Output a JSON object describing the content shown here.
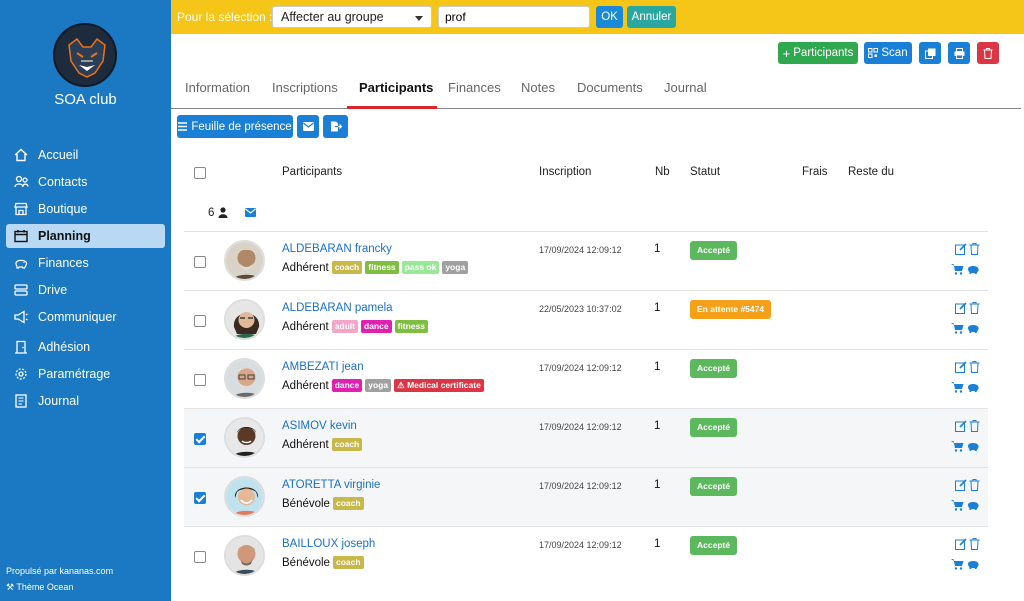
{
  "sidebar": {
    "club_name": "SOA club",
    "items": [
      {
        "label": "Accueil",
        "icon": "home-icon"
      },
      {
        "label": "Contacts",
        "icon": "users-icon"
      },
      {
        "label": "Boutique",
        "icon": "store-icon"
      },
      {
        "label": "Planning",
        "icon": "calendar-icon",
        "active": true
      },
      {
        "label": "Finances",
        "icon": "piggy-bank-icon"
      },
      {
        "label": "Drive",
        "icon": "drive-icon"
      },
      {
        "label": "Communiquer",
        "icon": "megaphone-icon"
      },
      {
        "label": "Adhésion",
        "icon": "door-icon"
      },
      {
        "label": "Paramétrage",
        "icon": "gear-icon"
      },
      {
        "label": "Journal",
        "icon": "journal-icon"
      }
    ],
    "footer_powered": "Propulsé par kananas.com",
    "footer_theme": "Thème Ocean"
  },
  "selection_bar": {
    "label": "Pour la sélection :",
    "action_value": "Affecter au groupe",
    "group_value": "prof",
    "ok_label": "OK",
    "cancel_label": "Annuler"
  },
  "actions": {
    "participants_label": "Participants",
    "scan_label": "Scan"
  },
  "tabs": [
    "Information",
    "Inscriptions",
    "Participants",
    "Finances",
    "Notes",
    "Documents",
    "Journal"
  ],
  "active_tab": "Participants",
  "toolbar": {
    "presence_label": "Feuille de présence"
  },
  "table": {
    "headers": {
      "participants": "Participants",
      "inscription": "Inscription",
      "nb": "Nb",
      "statut": "Statut",
      "frais": "Frais",
      "reste": "Reste du"
    },
    "count": "6"
  },
  "colors": {
    "coach": "#c8b84a",
    "fitness": "#7fbf3f",
    "pass_ok": "#98e898",
    "yoga": "#a0a0a0",
    "adult": "#f4a6c8",
    "dance": "#e020b0",
    "medical": "#dc3545",
    "accepte": "#5cb85c",
    "en_attente": "#f6a01a"
  },
  "rows": [
    {
      "name": "ALDEBARAN francky",
      "type": "Adhérent",
      "tags": [
        "coach",
        "fitness",
        "pass ok",
        "yoga"
      ],
      "date": "17/09/2024 12:09:12",
      "nb": "1",
      "status": "Accepté",
      "checked": false
    },
    {
      "name": "ALDEBARAN pamela",
      "type": "Adhérent",
      "tags": [
        "adult",
        "dance",
        "fitness"
      ],
      "date": "22/05/2023 10:37:02",
      "nb": "1",
      "status": "En attente #5474",
      "checked": false
    },
    {
      "name": "AMBEZATI jean",
      "type": "Adhérent",
      "tags": [
        "dance",
        "yoga",
        "Medical certificate"
      ],
      "date": "17/09/2024 12:09:12",
      "nb": "1",
      "status": "Accepté",
      "checked": false
    },
    {
      "name": "ASIMOV kevin",
      "type": "Adhérent",
      "tags": [
        "coach"
      ],
      "date": "17/09/2024 12:09:12",
      "nb": "1",
      "status": "Accepté",
      "checked": true
    },
    {
      "name": "ATORETTA virginie",
      "type": "Bénévole",
      "tags": [
        "coach"
      ],
      "date": "17/09/2024 12:09:12",
      "nb": "1",
      "status": "Accepté",
      "checked": true
    },
    {
      "name": "BAILLOUX joseph",
      "type": "Bénévole",
      "tags": [
        "coach"
      ],
      "date": "17/09/2024 12:09:12",
      "nb": "1",
      "status": "Accepté",
      "checked": false
    }
  ]
}
